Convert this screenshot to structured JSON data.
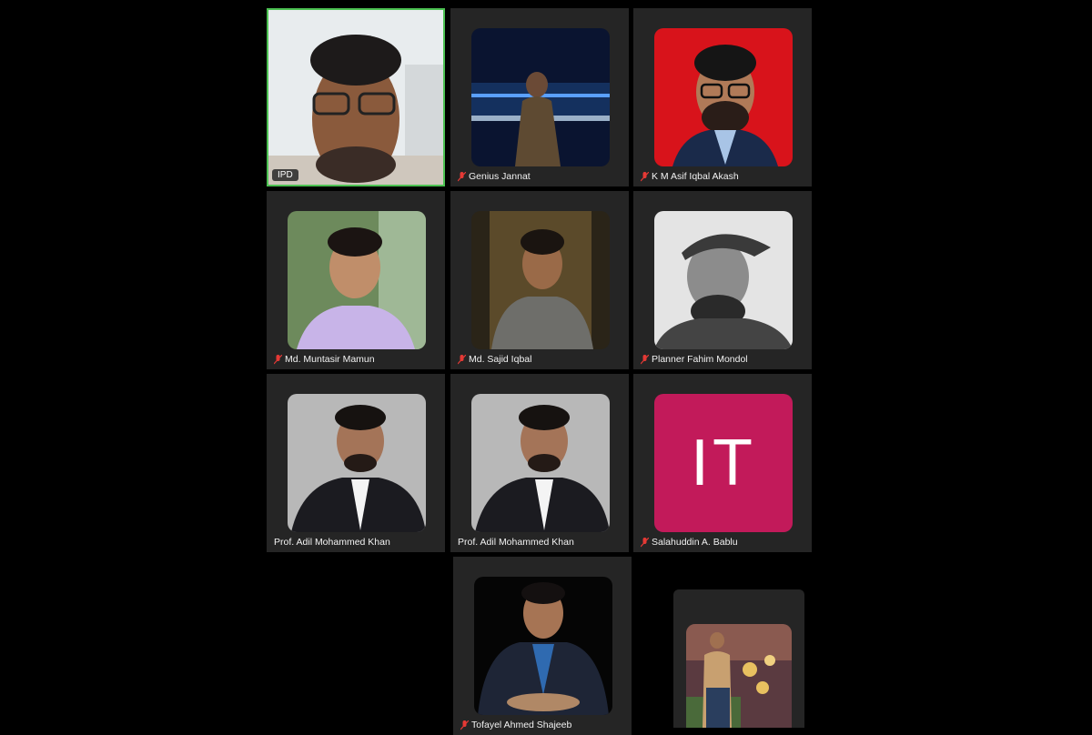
{
  "participants": [
    {
      "name": "IPD",
      "muted": false,
      "active": true
    },
    {
      "name": "Genius Jannat",
      "muted": true
    },
    {
      "name": "K M Asif Iqbal Akash",
      "muted": true
    },
    {
      "name": "Md. Muntasir Mamun",
      "muted": true
    },
    {
      "name": "Md. Sajid Iqbal",
      "muted": true
    },
    {
      "name": "Planner Fahim Mondol",
      "muted": true
    },
    {
      "name": "Prof. Adil Mohammed Khan",
      "muted": false
    },
    {
      "name": "Prof. Adil Mohammed Khan",
      "muted": false
    },
    {
      "name": "Salahuddin A. Bablu",
      "muted": true,
      "initials": "IT",
      "avatar_color": "#c21a5a"
    },
    {
      "name": "Tofayel Ahmed Shajeeb",
      "muted": true
    },
    {
      "name": "",
      "muted": false
    }
  ],
  "colors": {
    "active_border": "#4cc152",
    "muted_icon": "#e53935",
    "tile_bg": "#252525"
  }
}
